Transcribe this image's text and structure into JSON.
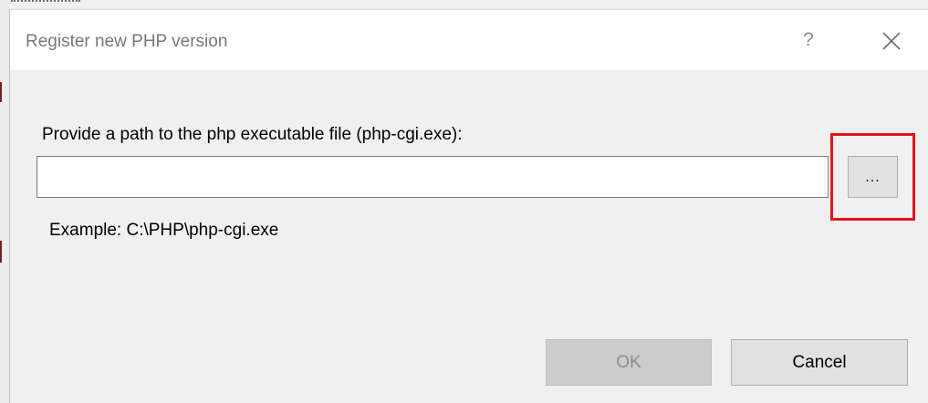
{
  "dialog": {
    "title": "Register new PHP version",
    "help_icon": "question-mark-icon",
    "help_label": "?",
    "close_icon": "close-icon"
  },
  "form": {
    "prompt_label": "Provide a path to the php executable file (php-cgi.exe):",
    "path_value": "",
    "browse_label": "...",
    "example_text": "Example: C:\\PHP\\php-cgi.exe"
  },
  "buttons": {
    "ok_label": "OK",
    "ok_enabled": false,
    "cancel_label": "Cancel"
  },
  "annotation": {
    "highlight_color": "#e0161c",
    "highlight_target": "browse-button"
  },
  "colors": {
    "dialog_background": "#f0f0f0",
    "titlebar_background": "#ffffff",
    "title_text": "#787878",
    "disabled_button": "#cccccc"
  }
}
